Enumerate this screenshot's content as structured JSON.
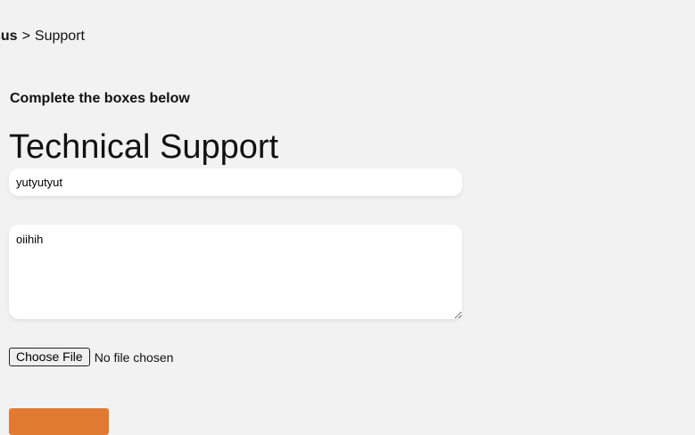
{
  "breadcrumb": {
    "root": "sus",
    "separator": ">",
    "current": "Support"
  },
  "form": {
    "instruction": "Complete the boxes below",
    "title": "Technical Support",
    "subject_value": "yutyutyut",
    "message_value": "oiihih",
    "file_button_label": "Choose File",
    "file_status": "No file chosen"
  },
  "colors": {
    "background": "#f2f2f2",
    "accent": "#e07a33"
  }
}
